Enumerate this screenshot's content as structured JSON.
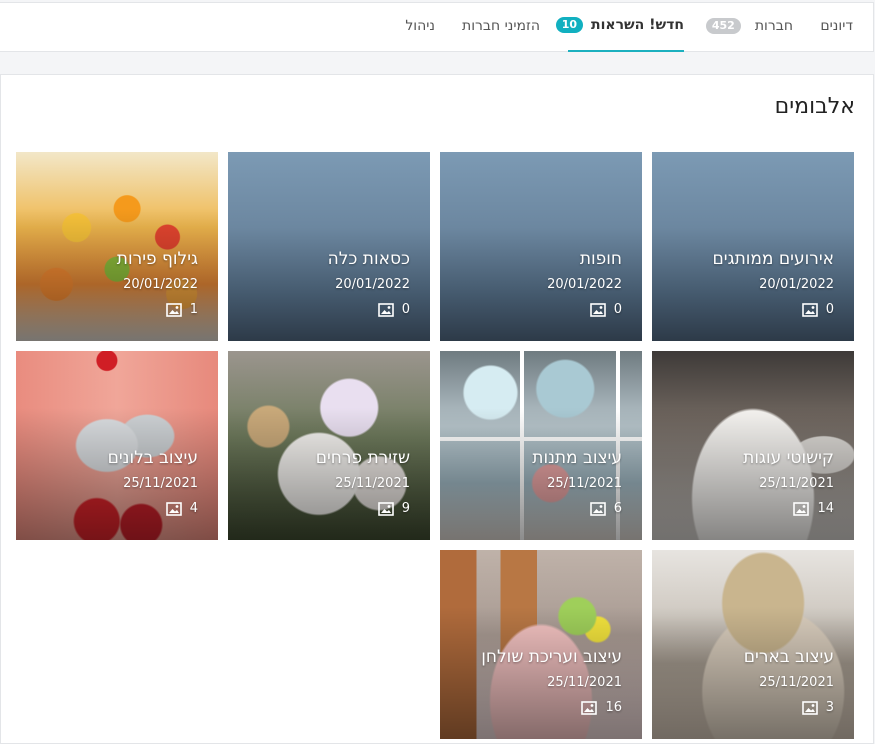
{
  "tabs": [
    {
      "label": "דיונים"
    },
    {
      "label": "חברות",
      "badge": "452"
    },
    {
      "label": "חדש! השראות",
      "badge": "10",
      "active": true
    },
    {
      "label": "הזמיני חברות"
    },
    {
      "label": "ניהול"
    }
  ],
  "section_title": "אלבומים",
  "albums": [
    {
      "title": "אירועים ממותגים",
      "date": "20/01/2022",
      "count": "0"
    },
    {
      "title": "חופות",
      "date": "20/01/2022",
      "count": "0"
    },
    {
      "title": "כסאות כלה",
      "date": "20/01/2022",
      "count": "0"
    },
    {
      "title": "גילוף פירות",
      "date": "20/01/2022",
      "count": "1"
    },
    {
      "title": "קישוטי עוגות",
      "date": "25/11/2021",
      "count": "14"
    },
    {
      "title": "עיצוב מתנות",
      "date": "25/11/2021",
      "count": "6"
    },
    {
      "title": "שזירת פרחים",
      "date": "25/11/2021",
      "count": "9"
    },
    {
      "title": "עיצוב בלונים",
      "date": "25/11/2021",
      "count": "4"
    },
    {
      "title": "עיצוב בארים",
      "date": "25/11/2021",
      "count": "3"
    },
    {
      "title": "עיצוב ועריכת שולחן",
      "date": "25/11/2021",
      "count": "16"
    }
  ],
  "colors": {
    "accent": "#11b0c0",
    "badge_gray": "#c8cacd"
  },
  "icons": {
    "photo_count": "image-icon"
  }
}
